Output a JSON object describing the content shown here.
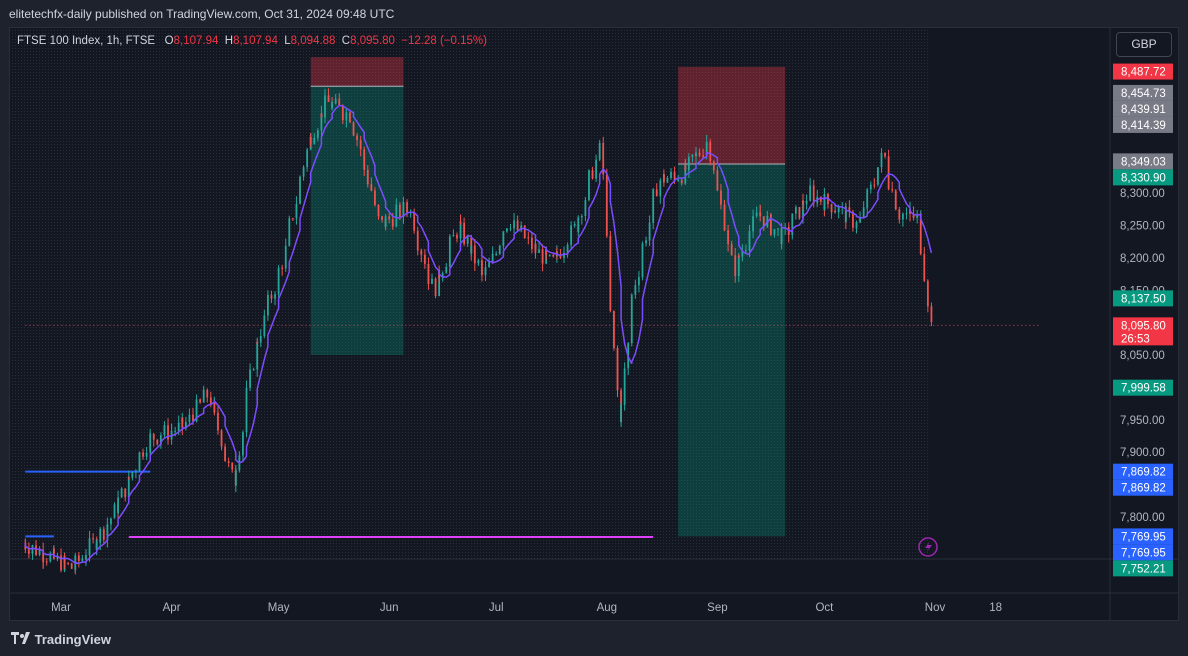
{
  "header": {
    "published": "elitetechfx-daily published on TradingView.com, Oct 31, 2024 09:48 UTC"
  },
  "legend": {
    "symbol": "FTSE 100 Index, 1h, FTSE",
    "o_label": "O",
    "o": "8,107.94",
    "h_label": "H",
    "h": "8,107.94",
    "l_label": "L",
    "l": "8,094.88",
    "c_label": "C",
    "c": "8,095.80",
    "change": "−12.28 (−0.15%)"
  },
  "currency": "GBP",
  "footer": {
    "brand": "TradingView"
  },
  "colors": {
    "up": "#26a69a",
    "down": "#ef5350",
    "ma": "#7b4dff",
    "current": "#f23645",
    "target": "#089981",
    "stop": "#f23645",
    "gray": "#787b86",
    "blue": "#2962ff",
    "magenta": "#e040fb"
  },
  "chart_data": {
    "type": "candlestick",
    "timeframe": "1h",
    "y_axis_ticks": [
      8300,
      8250,
      8200,
      8150,
      8050,
      7950,
      7900,
      7800
    ],
    "y_tick_labels": [
      "8,300.00",
      "8,250.00",
      "8,200.00",
      "8,150.00",
      "8,050.00",
      "7,950.00",
      "7,900.00",
      "7,800.00"
    ],
    "ylim": [
      7735,
      8555
    ],
    "x_axis_labels": [
      "Mar",
      "Apr",
      "May",
      "Jun",
      "Jul",
      "Aug",
      "Sep",
      "Oct",
      "Nov",
      "18"
    ],
    "x_axis_dates": [
      "2024-03-01",
      "2024-04-01",
      "2024-05-01",
      "2024-06-01",
      "2024-07-01",
      "2024-08-01",
      "2024-09-01",
      "2024-10-01",
      "2024-11-01",
      "2024-11-18"
    ],
    "price_path": [
      {
        "d": "2024-02-20",
        "p": 7760
      },
      {
        "d": "2024-03-05",
        "p": 7720
      },
      {
        "d": "2024-03-15",
        "p": 7790
      },
      {
        "d": "2024-03-26",
        "p": 7920
      },
      {
        "d": "2024-04-05",
        "p": 7940
      },
      {
        "d": "2024-04-12",
        "p": 7990
      },
      {
        "d": "2024-04-19",
        "p": 7850
      },
      {
        "d": "2024-04-25",
        "p": 8060
      },
      {
        "d": "2024-05-03",
        "p": 8200
      },
      {
        "d": "2024-05-10",
        "p": 8380
      },
      {
        "d": "2024-05-15",
        "p": 8440
      },
      {
        "d": "2024-05-22",
        "p": 8420
      },
      {
        "d": "2024-05-30",
        "p": 8250
      },
      {
        "d": "2024-06-07",
        "p": 8280
      },
      {
        "d": "2024-06-14",
        "p": 8150
      },
      {
        "d": "2024-06-21",
        "p": 8250
      },
      {
        "d": "2024-06-28",
        "p": 8170
      },
      {
        "d": "2024-07-05",
        "p": 8260
      },
      {
        "d": "2024-07-11",
        "p": 8220
      },
      {
        "d": "2024-07-17",
        "p": 8190
      },
      {
        "d": "2024-07-24",
        "p": 8250
      },
      {
        "d": "2024-07-31",
        "p": 8380
      },
      {
        "d": "2024-08-02",
        "p": 8180
      },
      {
        "d": "2024-08-05",
        "p": 7940
      },
      {
        "d": "2024-08-09",
        "p": 8150
      },
      {
        "d": "2024-08-16",
        "p": 8320
      },
      {
        "d": "2024-08-23",
        "p": 8330
      },
      {
        "d": "2024-08-30",
        "p": 8380
      },
      {
        "d": "2024-09-06",
        "p": 8180
      },
      {
        "d": "2024-09-13",
        "p": 8270
      },
      {
        "d": "2024-09-20",
        "p": 8230
      },
      {
        "d": "2024-09-27",
        "p": 8300
      },
      {
        "d": "2024-10-04",
        "p": 8280
      },
      {
        "d": "2024-10-11",
        "p": 8250
      },
      {
        "d": "2024-10-18",
        "p": 8360
      },
      {
        "d": "2024-10-22",
        "p": 8270
      },
      {
        "d": "2024-10-28",
        "p": 8260
      },
      {
        "d": "2024-10-31",
        "p": 8096
      }
    ],
    "positions": [
      {
        "name": "may-short",
        "start": "2024-05-10",
        "end": "2024-06-05",
        "entry": 8465,
        "stop": 8510,
        "target": 8050
      },
      {
        "name": "sep-short",
        "start": "2024-08-21",
        "end": "2024-09-20",
        "entry": 8345,
        "stop": 8495,
        "target": 7770
      }
    ],
    "horizontal_lines": [
      {
        "name": "blue-line-upper",
        "start": "2024-02-20",
        "end": "2024-03-26",
        "price": 7870,
        "color": "#2962ff"
      },
      {
        "name": "blue-line-lower",
        "start": "2024-02-20",
        "end": "2024-02-28",
        "price": 7770,
        "color": "#2962ff"
      },
      {
        "name": "magenta-line",
        "start": "2024-03-20",
        "end": "2024-08-14",
        "price": 7769,
        "color": "#e040fb"
      },
      {
        "name": "current-price-line",
        "start": "2024-02-20",
        "end": "2024-11-30",
        "price": 8095.8,
        "color": "#f23645"
      }
    ],
    "price_labels": [
      {
        "text": "8,487.72",
        "price": 8487.72,
        "color": "#f23645"
      },
      {
        "text": "8,454.73",
        "price": 8454.73,
        "color": "#787b86"
      },
      {
        "text": "8,439.91",
        "price": 8439.91,
        "color": "#787b86"
      },
      {
        "text": "8,414.39",
        "price": 8414.39,
        "color": "#787b86"
      },
      {
        "text": "8,349.03",
        "price": 8349.03,
        "color": "#787b86"
      },
      {
        "text": "8,330.90",
        "price": 8330.9,
        "color": "#089981"
      },
      {
        "text": "8,137.50",
        "price": 8137.5,
        "color": "#089981"
      },
      {
        "text": "8,095.80",
        "price": 8095.8,
        "color": "#f23645",
        "sub": "26:53"
      },
      {
        "text": "7,999.58",
        "price": 7999.58,
        "color": "#089981"
      },
      {
        "text": "7,869.82",
        "price": 7869.82,
        "color": "#2962ff"
      },
      {
        "text": "7,869.82",
        "price": 7869.82,
        "color": "#2962ff"
      },
      {
        "text": "7,769.95",
        "price": 7769.95,
        "color": "#2962ff"
      },
      {
        "text": "7,769.95",
        "price": 7769.95,
        "color": "#2962ff"
      },
      {
        "text": "7,752.21",
        "price": 7752.21,
        "color": "#089981"
      }
    ]
  }
}
